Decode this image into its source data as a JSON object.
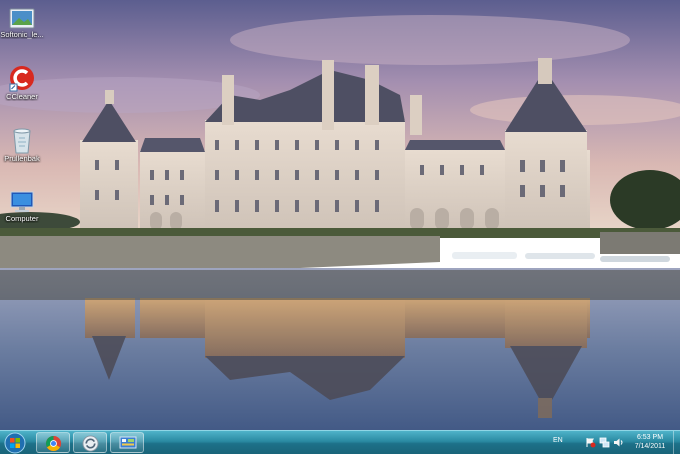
{
  "desktop": {
    "icons": [
      {
        "label": "Softonic_le...",
        "icon": "softonic-window-icon"
      },
      {
        "label": "CCleaner",
        "icon": "ccleaner-icon"
      },
      {
        "label": "Prullenbak",
        "icon": "recycle-bin-icon"
      },
      {
        "label": "Computer",
        "icon": "computer-icon"
      }
    ],
    "wallpaper": "chateau-reflection-wallpaper"
  },
  "taskbar": {
    "pinned": [
      {
        "icon": "chrome-icon"
      },
      {
        "icon": "sync-circle-icon"
      },
      {
        "icon": "control-panel-icon"
      }
    ],
    "language": "EN",
    "time": "6:53 PM",
    "date": "7/14/2011"
  },
  "colors": {
    "taskbar": "#2a8aa2",
    "sky_top": "#6d6fa0",
    "water": "#5b6f95"
  }
}
